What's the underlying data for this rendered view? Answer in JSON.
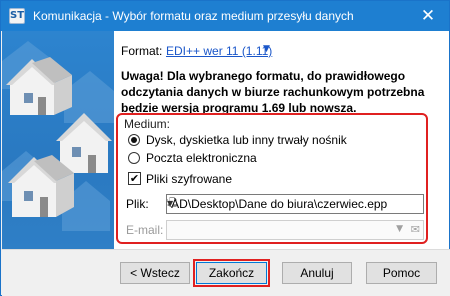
{
  "window": {
    "title": "Komunikacja - Wybór formatu oraz medium przesyłu danych",
    "icon_text": "ST",
    "close_glyph": "✕"
  },
  "format": {
    "label": "Format:",
    "value": "EDI++ wer 11 (1.11)",
    "arrow": "▼"
  },
  "warning": {
    "lines": [
      "Uwaga! Dla wybranego formatu, do prawidłowego",
      "odczytania danych w biurze rachunkowym potrzebna",
      "będzie wersja programu 1.69 lub nowsza."
    ]
  },
  "medium": {
    "label": "Medium:",
    "options": [
      {
        "label": "Dysk, dyskietka lub inny trwały nośnik",
        "selected": true
      },
      {
        "label": "Poczta elektroniczna",
        "selected": false
      }
    ],
    "encrypted": {
      "label": "Pliki szyfrowane",
      "checked": true,
      "mark": "✔"
    },
    "file": {
      "label": "Plik:",
      "value": "RT-AD\\Desktop\\Dane do biura\\czerwiec.epp",
      "dropdown_glyph": "▼",
      "browse_glyph": "🗋"
    },
    "email": {
      "label": "E-mail:",
      "value": "",
      "dropdown_glyph": "▼",
      "addressbook_glyph": "✉"
    }
  },
  "buttons": {
    "back": "< Wstecz",
    "finish": "Zakończ",
    "cancel": "Anuluj",
    "help": "Pomoc"
  },
  "colors": {
    "titlebar": "#1e7fd1",
    "link": "#1a56c9",
    "highlight": "#e02020",
    "side_art": "#2d84cf"
  }
}
